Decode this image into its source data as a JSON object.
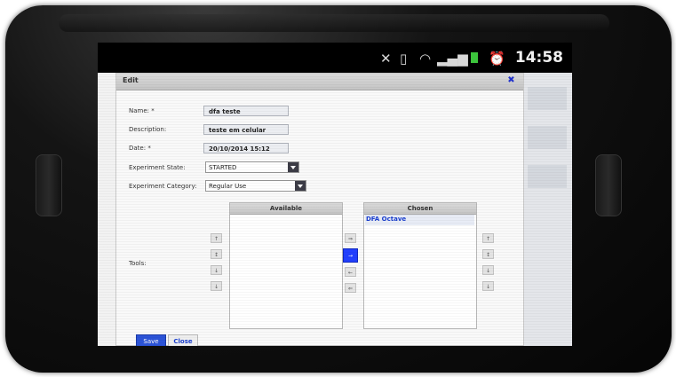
{
  "status_bar": {
    "icons": [
      "mute-icon",
      "vibrate-icon",
      "wifi-icon",
      "signal-icon",
      "battery-icon",
      "alarm-icon"
    ],
    "time": "14:58"
  },
  "dialog": {
    "title": "Edit",
    "close_symbol": "✖",
    "fields": {
      "name": {
        "label": "Name: *",
        "value": "dfa teste"
      },
      "description": {
        "label": "Description:",
        "value": "teste em celular"
      },
      "date": {
        "label": "Date: *",
        "value": "20/10/2014 15:12"
      },
      "state": {
        "label": "Experiment State:",
        "value": "STARTED"
      },
      "category": {
        "label": "Experiment Category:",
        "value": "Regular Use"
      }
    },
    "tools": {
      "label": "Tools:",
      "available": {
        "header": "Available",
        "items": []
      },
      "chosen": {
        "header": "Chosen",
        "items": [
          "DFA Octave"
        ]
      },
      "left_sort_buttons": [
        "↑",
        "↕",
        "↓",
        "↓"
      ],
      "move_buttons": [
        "⇒",
        "→",
        "←",
        "⇐"
      ],
      "right_sort_buttons": [
        "↑",
        "↕",
        "↓",
        "↓"
      ]
    },
    "buttons": {
      "save": "Save",
      "close": "Close"
    }
  },
  "colors": {
    "accent": "#2240ff",
    "link": "#1a3fd0"
  }
}
